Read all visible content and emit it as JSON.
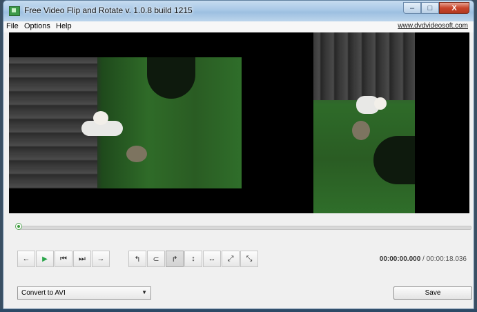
{
  "window": {
    "title": "Free Video Flip and Rotate v. 1.0.8 build 1215"
  },
  "caption_buttons": {
    "minimize": "–",
    "maximize": "□",
    "close": "X"
  },
  "menu": {
    "items": [
      "File",
      "Options",
      "Help"
    ],
    "site_link": "www.dvdvideosoft.com"
  },
  "seek": {
    "position": 0.0
  },
  "playback_buttons": [
    {
      "name": "step-back-button",
      "icon": "arrow-left-icon",
      "glyph": "←"
    },
    {
      "name": "play-button",
      "icon": "play-icon",
      "glyph": "▶"
    },
    {
      "name": "skip-start-button",
      "icon": "skip-start-icon",
      "glyph": "⏮"
    },
    {
      "name": "skip-end-button",
      "icon": "skip-end-icon",
      "glyph": "⏭"
    },
    {
      "name": "step-forward-button",
      "icon": "arrow-right-icon",
      "glyph": "→"
    }
  ],
  "transform_buttons": [
    {
      "name": "rotate-left-button",
      "icon": "rotate-left-icon",
      "glyph": "↰"
    },
    {
      "name": "rotate-180-button",
      "icon": "rotate-180-icon",
      "glyph": "⊂"
    },
    {
      "name": "rotate-right-button",
      "icon": "rotate-right-icon",
      "glyph": "↱",
      "active": true
    },
    {
      "name": "flip-vertical-button",
      "icon": "flip-vertical-icon",
      "glyph": "↕"
    },
    {
      "name": "flip-horizontal-button",
      "icon": "flip-horizontal-icon",
      "glyph": "↔"
    },
    {
      "name": "transpose-button",
      "icon": "diagonal-icon",
      "glyph": "⤢"
    },
    {
      "name": "transverse-button",
      "icon": "anti-diagonal-icon",
      "glyph": "⤡"
    }
  ],
  "time": {
    "current": "00:00:00.000",
    "separator": "/",
    "total": "00:00:18.036"
  },
  "convert": {
    "selected": "Convert to AVI",
    "arrow": "▼"
  },
  "save": {
    "label": "Save"
  }
}
